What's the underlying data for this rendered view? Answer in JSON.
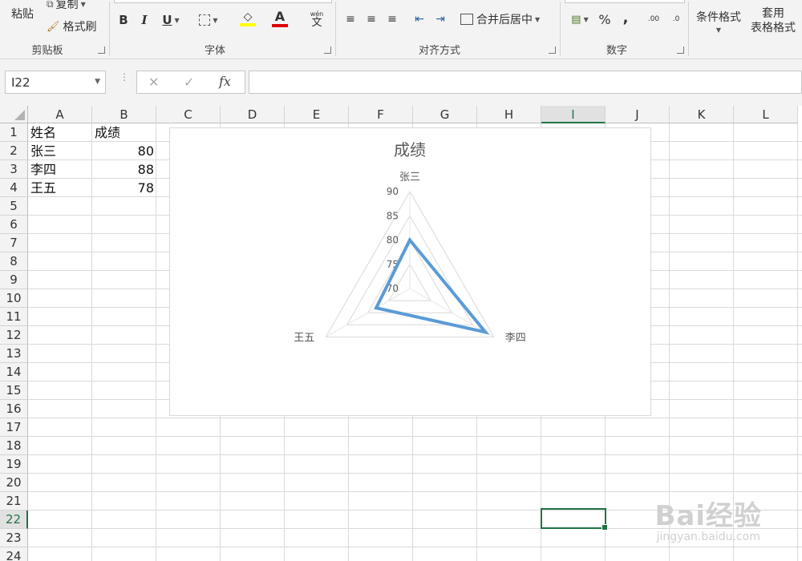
{
  "ribbon": {
    "clipboard": {
      "paste": "粘贴",
      "copy": "复制",
      "format_painter": "格式刷",
      "label": "剪贴板"
    },
    "font": {
      "bold": "B",
      "italic": "I",
      "underline": "U",
      "font_color_glyph": "A",
      "phonetic": "wén",
      "phonetic_char": "文",
      "label": "字体"
    },
    "align": {
      "merge_center": "合并后居中",
      "label": "对齐方式"
    },
    "number": {
      "percent": "%",
      "comma": ",",
      "inc_decimal": ".00",
      "dec_decimal": ".0",
      "label": "数字"
    },
    "styles": {
      "conditional": "条件格式",
      "table_line1": "套用",
      "table_line2": "表格格式"
    },
    "accent_colors": {
      "highlight": "#ffff00",
      "font_color": "#ff0000"
    }
  },
  "formula_bar": {
    "name_box": "I22",
    "cancel": "✕",
    "enter": "✓",
    "fx": "fx",
    "formula": ""
  },
  "sheet": {
    "columns": [
      "A",
      "B",
      "C",
      "D",
      "E",
      "F",
      "G",
      "H",
      "I",
      "J",
      "K",
      "L"
    ],
    "selected_column": "I",
    "rows": [
      "1",
      "2",
      "3",
      "4",
      "5",
      "6",
      "7",
      "8",
      "9",
      "10",
      "11",
      "12",
      "13",
      "14",
      "15",
      "16",
      "17",
      "18",
      "19",
      "20",
      "21",
      "22",
      "23",
      "24"
    ],
    "selected_row": "22",
    "cells": {
      "A1": "姓名",
      "B1": "成绩",
      "A2": "张三",
      "B2": "80",
      "A3": "李四",
      "B3": "88",
      "A4": "王五",
      "B4": "78"
    }
  },
  "chart_data": {
    "type": "radar",
    "title": "成绩",
    "categories": [
      "张三",
      "李四",
      "王五"
    ],
    "series": [
      {
        "values": [
          80,
          88,
          78
        ],
        "color": "#5b9bd5"
      }
    ],
    "rlim": [
      70,
      90
    ],
    "ticks": [
      "70",
      "75",
      "80",
      "85",
      "90"
    ],
    "grid": true,
    "legend": "none"
  },
  "watermark": {
    "brand": "Bai经验",
    "url": "jingyan.baidu.com"
  }
}
